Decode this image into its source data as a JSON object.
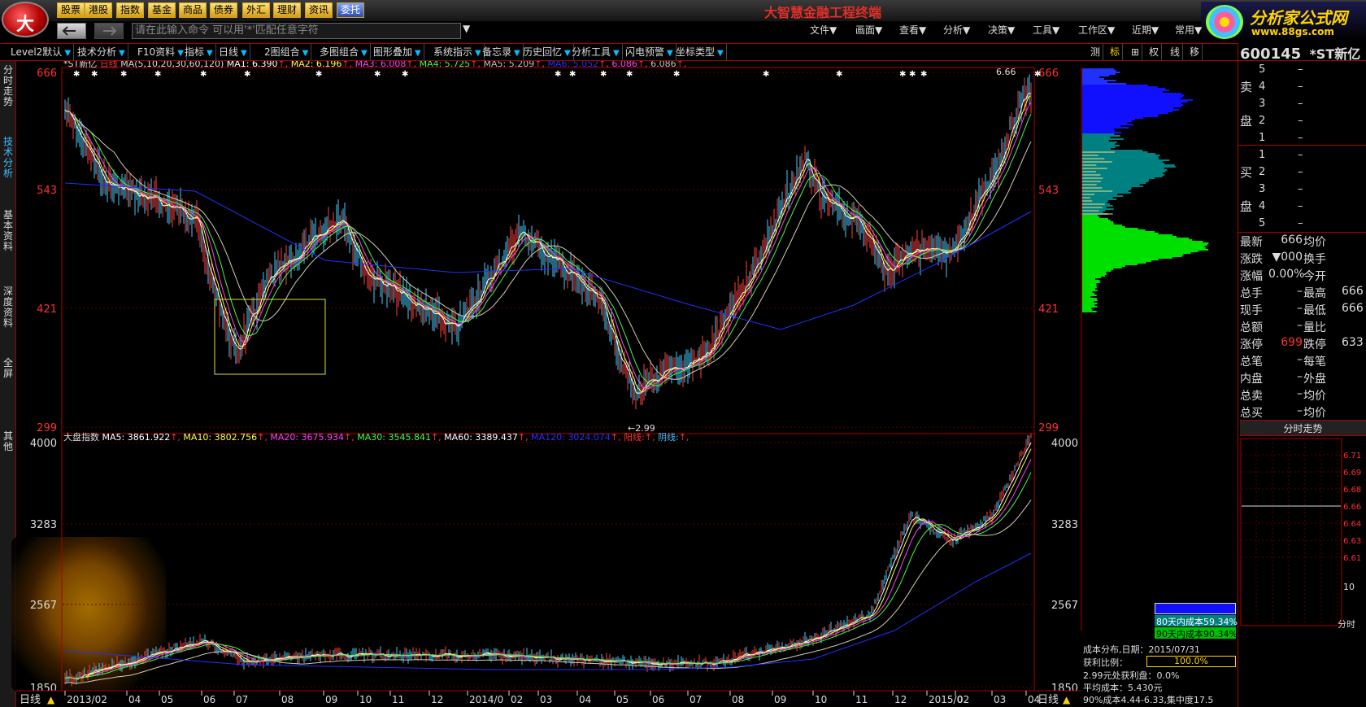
{
  "top_nav": {
    "buttons": [
      "股票",
      "港股",
      "指数",
      "基金",
      "商品",
      "债券",
      "外汇",
      "理财",
      "资讯",
      "委托"
    ],
    "title": "大智慧金融工程终端"
  },
  "menu": [
    "文件▼",
    "画面▼",
    "查看▼",
    "分析▼",
    "决策▼",
    "工具▼",
    "工作区▼",
    "近期▼",
    "常用▼"
  ],
  "command": {
    "placeholder": "请在此输入命令   可以用'*'匹配任意字符"
  },
  "brand": {
    "name": "分析家公式网",
    "url": "www.88gs.com"
  },
  "toolbar": [
    "Level2默认",
    "技术分析",
    "F10资料",
    "指标",
    "日线",
    "2图组合",
    "多图组合",
    "图形叠加",
    "系统指示",
    "备忘录",
    "历史回忆",
    "分析工具",
    "闪电预警",
    "坐标类型"
  ],
  "toolbar_right": [
    "测",
    "标",
    "⊞",
    "权",
    "线",
    "移"
  ],
  "left_tabs": [
    "分时走势",
    "技术分析",
    "基本资料",
    "深度资料",
    "全屏",
    "其他"
  ],
  "stock": {
    "code": "600145",
    "name": "*ST新亿"
  },
  "main_chart": {
    "legend_title": "*ST新亿",
    "period": "日线",
    "ma_spec": "MA(5,10,20,30,60,120)",
    "ma": [
      {
        "label": "MA1: 6.390",
        "color": "#ffffff"
      },
      {
        "label": "MA2: 6.196",
        "color": "#ffff40"
      },
      {
        "label": "MA3: 6.008",
        "color": "#ff40ff"
      },
      {
        "label": "MA4: 5.725",
        "color": "#40ff40"
      },
      {
        "label": "MA5: 5.209",
        "color": "#c0c0c0"
      },
      {
        "label": "MA6: 5.052",
        "color": "#2030ff"
      },
      {
        "label": "6.086",
        "color": "#ff40ff"
      },
      {
        "label": "6.086",
        "color": "#c0c0c0"
      }
    ],
    "y_ticks": [
      "666",
      "543",
      "421",
      "299"
    ],
    "annot_high": "6.66",
    "annot_low": "2.99"
  },
  "sub_chart": {
    "legend_title": "大盘指数",
    "ma": [
      {
        "label": "MA5: 3861.922",
        "color": "#ffffff"
      },
      {
        "label": "MA10: 3802.756",
        "color": "#ffff40"
      },
      {
        "label": "MA20: 3675.934",
        "color": "#ff40ff"
      },
      {
        "label": "MA30: 3545.841",
        "color": "#40ff40"
      },
      {
        "label": "MA60: 3389.437",
        "color": "#ffffff"
      },
      {
        "label": "MA120: 3024.074",
        "color": "#2030ff"
      },
      {
        "label": "阳线:",
        "color": "#ff3030"
      },
      {
        "label": "阴线:",
        "color": "#40c0ff"
      }
    ],
    "y_ticks": [
      "4000",
      "3283",
      "2567",
      "1850"
    ]
  },
  "x_axis": {
    "period_label": "日线",
    "ticks": [
      "2013/02",
      "04",
      "05",
      "06",
      "07",
      "08",
      "09",
      "10",
      "11",
      "12",
      "2014/0",
      "02",
      "03",
      "04",
      "05",
      "06",
      "07",
      "08",
      "09",
      "10",
      "11",
      "12",
      "2015/0",
      "02",
      "03",
      "04"
    ]
  },
  "order_book": {
    "ask_label": [
      "卖",
      "盘"
    ],
    "bid_label": [
      "买",
      "盘"
    ],
    "asks": [
      {
        "lvl": "5",
        "p": "–"
      },
      {
        "lvl": "4",
        "p": "–"
      },
      {
        "lvl": "3",
        "p": "–"
      },
      {
        "lvl": "2",
        "p": "–"
      },
      {
        "lvl": "1",
        "p": "–"
      }
    ],
    "bids": [
      {
        "lvl": "1",
        "p": "–"
      },
      {
        "lvl": "2",
        "p": "–"
      },
      {
        "lvl": "3",
        "p": "–"
      },
      {
        "lvl": "4",
        "p": "–"
      },
      {
        "lvl": "5",
        "p": "–"
      }
    ]
  },
  "quote": [
    {
      "a": "最新",
      "av": "666",
      "b": "均价",
      "bv": ""
    },
    {
      "a": "涨跌",
      "av": "▼000",
      "b": "换手",
      "bv": ""
    },
    {
      "a": "涨幅",
      "av": "0.00%",
      "b": "今开",
      "bv": ""
    },
    {
      "a": "总手",
      "av": "–",
      "b": "最高",
      "bv": "666"
    },
    {
      "a": "现手",
      "av": "–",
      "b": "最低",
      "bv": "666"
    },
    {
      "a": "总额",
      "av": "–",
      "b": "量比",
      "bv": ""
    },
    {
      "a": "涨停",
      "av": "699",
      "b": "跌停",
      "bv": "633"
    },
    {
      "a": "总笔",
      "av": "–",
      "b": "每笔",
      "bv": ""
    },
    {
      "a": "内盘",
      "av": "–",
      "b": "外盘",
      "bv": ""
    },
    {
      "a": "总卖",
      "av": "–",
      "b": "均价",
      "bv": ""
    },
    {
      "a": "总买",
      "av": "–",
      "b": "均价",
      "bv": ""
    }
  ],
  "minute": {
    "title": "分时走势",
    "ticks": [
      "6.71",
      "6.69",
      "6.68",
      "6.66",
      "6.64",
      "6.63",
      "6.61"
    ],
    "left_tick": "10",
    "bottom": "分时"
  },
  "cost": {
    "box": [
      "",
      "80天内成本59.34%",
      "90天内成本90.34%"
    ],
    "title": "成本分布,日期：2015/07/31",
    "ratio_label": "获利比例：",
    "ratio": "100.0%",
    "lines": [
      "2.99元处获利盘：0.0%",
      "平均成本：5.430元",
      "90%成本4.44-6.33,集中度17.5"
    ]
  },
  "colors": {
    "red_frame": "#aa0000",
    "ask": "#1010ff",
    "mid": "#008080",
    "bid": "#00e000"
  }
}
